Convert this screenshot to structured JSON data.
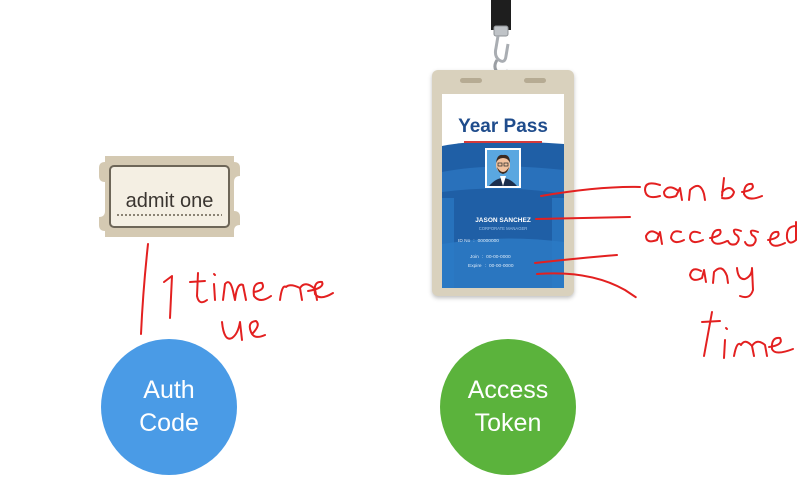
{
  "ticket": {
    "text": "admit one"
  },
  "badge": {
    "title": "Year Pass",
    "name": "JASON SANCHEZ",
    "role": "CORPORATE MANAGER",
    "id_label": "ID No",
    "id_value": "00000000",
    "join_label": "Join",
    "join_value": "00-00-0000",
    "expire_label": "Expire",
    "expire_value": "00-00-0000"
  },
  "circles": {
    "auth": {
      "line1": "Auth",
      "line2": "Code",
      "color": "#4a9be6"
    },
    "access": {
      "line1": "Access",
      "line2": "Token",
      "color": "#5bb33c"
    }
  },
  "annotations": {
    "left": "1 time use",
    "right": "Can be accessed any time",
    "ink_color": "#e32020"
  }
}
